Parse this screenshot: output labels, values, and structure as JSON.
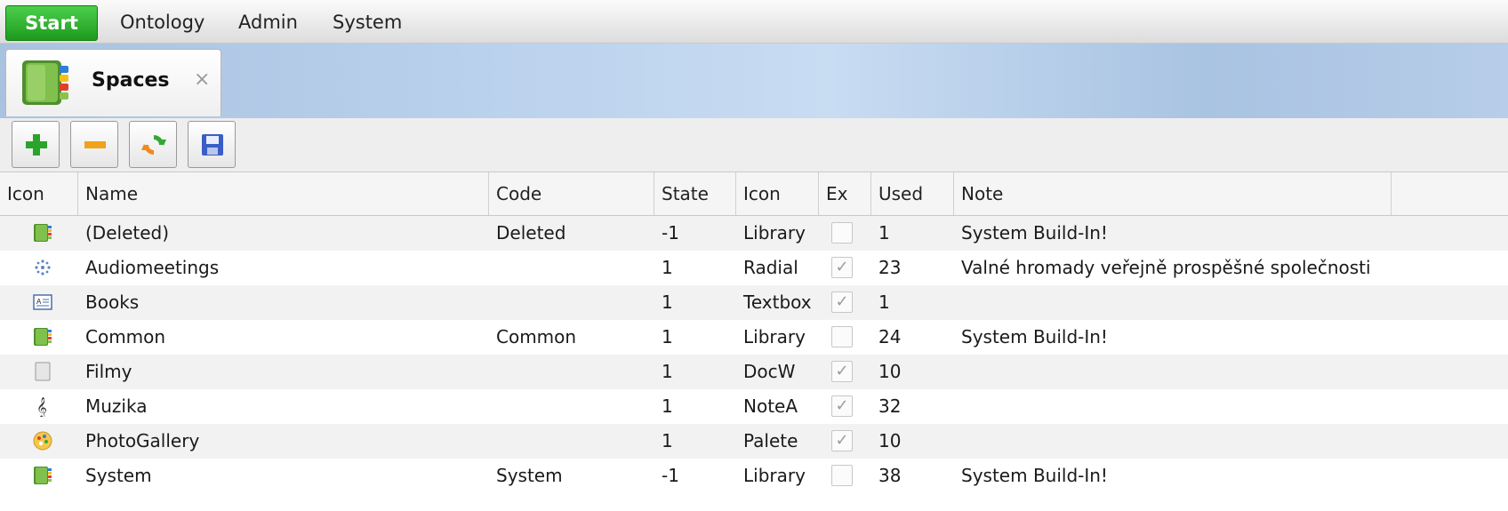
{
  "menu": {
    "start": "Start",
    "items": [
      "Ontology",
      "Admin",
      "System"
    ]
  },
  "tab": {
    "label": "Spaces",
    "close": "×"
  },
  "toolbar": {
    "buttons": [
      "add-icon",
      "remove-icon",
      "refresh-icon",
      "save-icon"
    ]
  },
  "grid": {
    "headers": [
      "Icon",
      "Name",
      "Code",
      "State",
      "Icon",
      "Ex",
      "Used",
      "Note"
    ],
    "rows": [
      {
        "icon": "library-icon",
        "name": "(Deleted)",
        "code": "Deleted",
        "state": "-1",
        "icon_name": "Library",
        "checked": false,
        "used": "1",
        "note": "System Build-In!"
      },
      {
        "icon": "radial-icon",
        "name": "Audiomeetings",
        "code": "",
        "state": "1",
        "icon_name": "Radial",
        "checked": true,
        "used": "23",
        "note": "Valné hromady veřejně prospěšné společnosti"
      },
      {
        "icon": "textbox-icon",
        "name": "Books",
        "code": "",
        "state": "1",
        "icon_name": "Textbox",
        "checked": true,
        "used": "1",
        "note": ""
      },
      {
        "icon": "library-icon",
        "name": "Common",
        "code": "Common",
        "state": "1",
        "icon_name": "Library",
        "checked": false,
        "used": "24",
        "note": "System Build-In!"
      },
      {
        "icon": "document-icon",
        "name": "Filmy",
        "code": "",
        "state": "1",
        "icon_name": "DocW",
        "checked": true,
        "used": "10",
        "note": ""
      },
      {
        "icon": "treble-clef-icon",
        "name": "Muzika",
        "code": "",
        "state": "1",
        "icon_name": "NoteA",
        "checked": true,
        "used": "32",
        "note": ""
      },
      {
        "icon": "palette-icon",
        "name": "PhotoGallery",
        "code": "",
        "state": "1",
        "icon_name": "Palete",
        "checked": true,
        "used": "10",
        "note": ""
      },
      {
        "icon": "library-icon",
        "name": "System",
        "code": "System",
        "state": "-1",
        "icon_name": "Library",
        "checked": false,
        "used": "38",
        "note": "System Build-In!"
      }
    ]
  },
  "check_mark": "✓",
  "colors": {
    "start_green": "#2eaa2e",
    "banner_blue": "#b9d0ec",
    "row_alt": "#f2f2f2"
  }
}
